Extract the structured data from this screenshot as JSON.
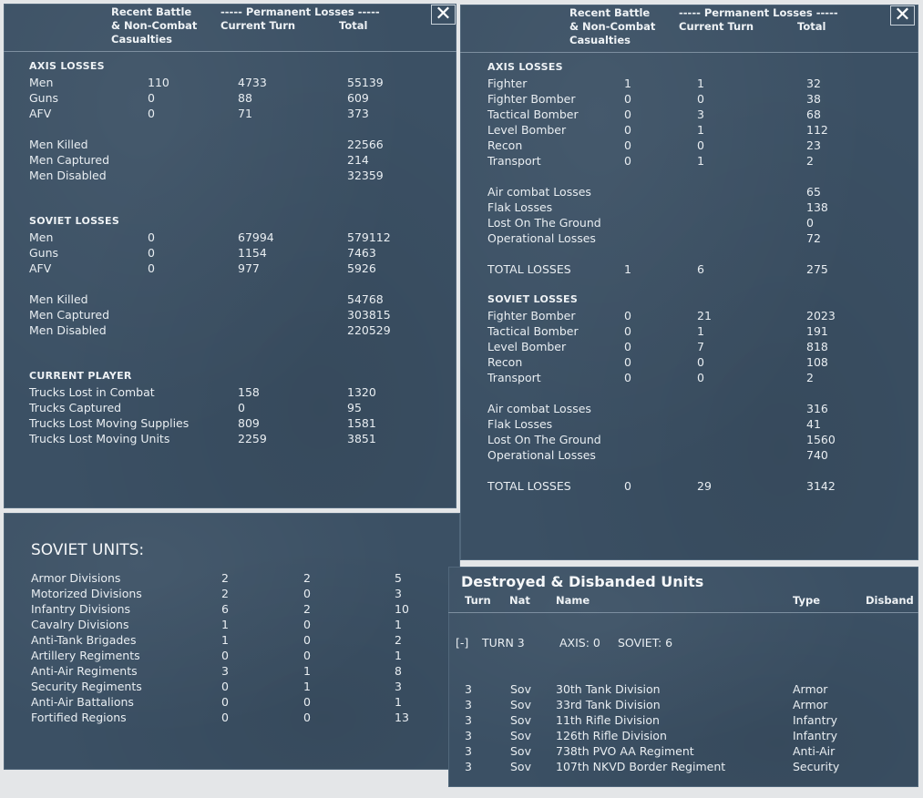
{
  "ground_losses": {
    "header": {
      "col1": "Recent Battle\n& Non-Combat\nCasualties",
      "perm": "----- Permanent Losses -----",
      "current": "Current Turn",
      "total": "Total"
    },
    "close_label": "✕",
    "axis": {
      "title": "AXIS LOSSES",
      "rows": [
        {
          "label": "Men",
          "recent": "110",
          "current": "4733",
          "total": "55139"
        },
        {
          "label": "Guns",
          "recent": "0",
          "current": "88",
          "total": "609"
        },
        {
          "label": "AFV",
          "recent": "0",
          "current": "71",
          "total": "373"
        }
      ],
      "detail": [
        {
          "label": "Men Killed",
          "total": "22566"
        },
        {
          "label": "Men Captured",
          "total": "214"
        },
        {
          "label": "Men Disabled",
          "total": "32359"
        }
      ]
    },
    "soviet": {
      "title": "SOVIET LOSSES",
      "rows": [
        {
          "label": "Men",
          "recent": "0",
          "current": "67994",
          "total": "579112"
        },
        {
          "label": "Guns",
          "recent": "0",
          "current": "1154",
          "total": "7463"
        },
        {
          "label": "AFV",
          "recent": "0",
          "current": "977",
          "total": "5926"
        }
      ],
      "detail": [
        {
          "label": "Men Killed",
          "total": "54768"
        },
        {
          "label": "Men Captured",
          "total": "303815"
        },
        {
          "label": "Men Disabled",
          "total": "220529"
        }
      ]
    },
    "player": {
      "title": "CURRENT PLAYER",
      "rows": [
        {
          "label": "Trucks Lost in Combat",
          "current": "158",
          "total": "1320"
        },
        {
          "label": "Trucks Captured",
          "current": "0",
          "total": "95"
        },
        {
          "label": "Trucks Lost Moving Supplies",
          "current": "809",
          "total": "1581"
        },
        {
          "label": "Trucks Lost Moving Units",
          "current": "2259",
          "total": "3851"
        }
      ]
    }
  },
  "air_losses": {
    "header": {
      "col1": "Recent Battle\n& Non-Combat\nCasualties",
      "perm": "----- Permanent Losses -----",
      "current": "Current Turn",
      "total": "Total"
    },
    "close_label": "✕",
    "axis": {
      "title": "AXIS LOSSES",
      "rows": [
        {
          "label": "Fighter",
          "recent": "1",
          "current": "1",
          "total": "32"
        },
        {
          "label": "Fighter Bomber",
          "recent": "0",
          "current": "0",
          "total": "38"
        },
        {
          "label": "Tactical Bomber",
          "recent": "0",
          "current": "3",
          "total": "68"
        },
        {
          "label": "Level Bomber",
          "recent": "0",
          "current": "1",
          "total": "112"
        },
        {
          "label": "Recon",
          "recent": "0",
          "current": "0",
          "total": "23"
        },
        {
          "label": "Transport",
          "recent": "0",
          "current": "1",
          "total": "2"
        }
      ],
      "detail": [
        {
          "label": "Air combat Losses",
          "total": "65"
        },
        {
          "label": "Flak Losses",
          "total": "138"
        },
        {
          "label": "Lost On The Ground",
          "total": "0"
        },
        {
          "label": "Operational Losses",
          "total": "72"
        }
      ],
      "totals": {
        "label": "TOTAL LOSSES",
        "recent": "1",
        "current": "6",
        "total": "275"
      }
    },
    "soviet": {
      "title": "SOVIET LOSSES",
      "rows": [
        {
          "label": "Fighter Bomber",
          "recent": "0",
          "current": "21",
          "total": "2023"
        },
        {
          "label": "Tactical Bomber",
          "recent": "0",
          "current": "1",
          "total": "191"
        },
        {
          "label": "Level Bomber",
          "recent": "0",
          "current": "7",
          "total": "818"
        },
        {
          "label": "Recon",
          "recent": "0",
          "current": "0",
          "total": "108"
        },
        {
          "label": "Transport",
          "recent": "0",
          "current": "0",
          "total": "2"
        }
      ],
      "detail": [
        {
          "label": "Air combat Losses",
          "total": "316"
        },
        {
          "label": "Flak Losses",
          "total": "41"
        },
        {
          "label": "Lost On The Ground",
          "total": "1560"
        },
        {
          "label": "Operational Losses",
          "total": "740"
        }
      ],
      "totals": {
        "label": "TOTAL LOSSES",
        "recent": "0",
        "current": "29",
        "total": "3142"
      }
    }
  },
  "soviet_units": {
    "title": "SOVIET UNITS:",
    "rows": [
      {
        "label": "Armor Divisions",
        "a": "2",
        "b": "2",
        "c": "5"
      },
      {
        "label": "Motorized Divisions",
        "a": "2",
        "b": "0",
        "c": "3"
      },
      {
        "label": "Infantry Divisions",
        "a": "6",
        "b": "2",
        "c": "10"
      },
      {
        "label": "Cavalry Divisions",
        "a": "1",
        "b": "0",
        "c": "1"
      },
      {
        "label": "Anti-Tank Brigades",
        "a": "1",
        "b": "0",
        "c": "2"
      },
      {
        "label": "Artillery Regiments",
        "a": "0",
        "b": "0",
        "c": "1"
      },
      {
        "label": "Anti-Air Regiments",
        "a": "3",
        "b": "1",
        "c": "8"
      },
      {
        "label": "Security Regiments",
        "a": "0",
        "b": "1",
        "c": "3"
      },
      {
        "label": "Anti-Air Battalions",
        "a": "0",
        "b": "0",
        "c": "1"
      },
      {
        "label": "Fortified Regions",
        "a": "0",
        "b": "0",
        "c": "13"
      }
    ]
  },
  "destroyed_units": {
    "title": "Destroyed & Disbanded Units",
    "columns": {
      "turn": "Turn",
      "nat": "Nat",
      "name": "Name",
      "type": "Type",
      "disband": "Disband"
    },
    "group": {
      "toggle": "[-]",
      "turn": "TURN 3",
      "axis": "AXIS: 0",
      "soviet": "SOVIET: 6"
    },
    "rows": [
      {
        "turn": "3",
        "nat": "Sov",
        "name": "30th Tank Division",
        "type": "Armor"
      },
      {
        "turn": "3",
        "nat": "Sov",
        "name": "33rd Tank Division",
        "type": "Armor"
      },
      {
        "turn": "3",
        "nat": "Sov",
        "name": "11th Rifle Division",
        "type": "Infantry"
      },
      {
        "turn": "3",
        "nat": "Sov",
        "name": "126th Rifle Division",
        "type": "Infantry"
      },
      {
        "turn": "3",
        "nat": "Sov",
        "name": "738th PVO AA Regiment",
        "type": "Anti-Air"
      },
      {
        "turn": "3",
        "nat": "Sov",
        "name": "107th NKVD Border Regiment",
        "type": "Security"
      }
    ]
  }
}
